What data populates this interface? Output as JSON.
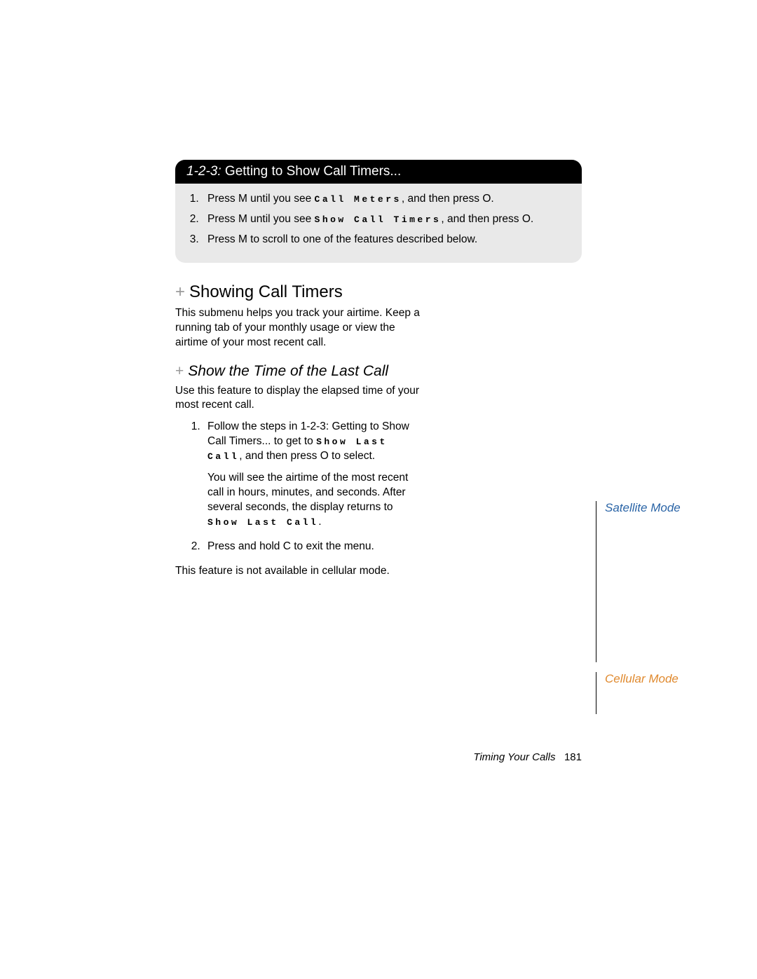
{
  "proc": {
    "prefix": "1-2-3:",
    "title": "Getting to Show Call Timers...",
    "steps": {
      "s1a": "Press ",
      "s1key1": "M",
      "s1b": " until you see ",
      "s1menu": "Call Meters",
      "s1c": ", and then press ",
      "s1key2": "O",
      "s1d": ".",
      "s2a": "Press ",
      "s2key1": "M",
      "s2b": " until you see ",
      "s2menu": "Show Call Timers",
      "s2c": ", and then press ",
      "s2key2": "O",
      "s2d": ".",
      "s3a": "Press ",
      "s3key": "M",
      "s3b": " to scroll to one of the features described below."
    }
  },
  "sec1": {
    "title": "Showing Call Timers",
    "para": "This submenu helps you track your airtime. Keep a running tab of your monthly usage or view the airtime of your most recent call."
  },
  "sec2": {
    "title": "Show the Time of the Last Call",
    "intro": "Use this feature to display the elapsed time of your most recent call.",
    "steps": {
      "s1a": "Follow the steps in ",
      "s1ref": "1-2-3: Getting to Show Call Timers...",
      "s1b": " to get to ",
      "s1menu": "Show Last Call",
      "s1c": ", and then press ",
      "s1key": "O",
      "s1d": " to select.",
      "s1note_a": "You will see the airtime of the most recent call in hours, minutes, and seconds. After several seconds, the display returns to ",
      "s1note_menu": "Show Last Call",
      "s1note_b": ".",
      "s2a": "Press and hold ",
      "s2key": "C",
      "s2b": " to exit the menu."
    },
    "note": "This feature is not available in cellular mode."
  },
  "side": {
    "sat": "Satellite Mode",
    "cell": "Cellular Mode"
  },
  "footer": {
    "chapter": "Timing Your Calls",
    "page": "181"
  },
  "plus": "+"
}
